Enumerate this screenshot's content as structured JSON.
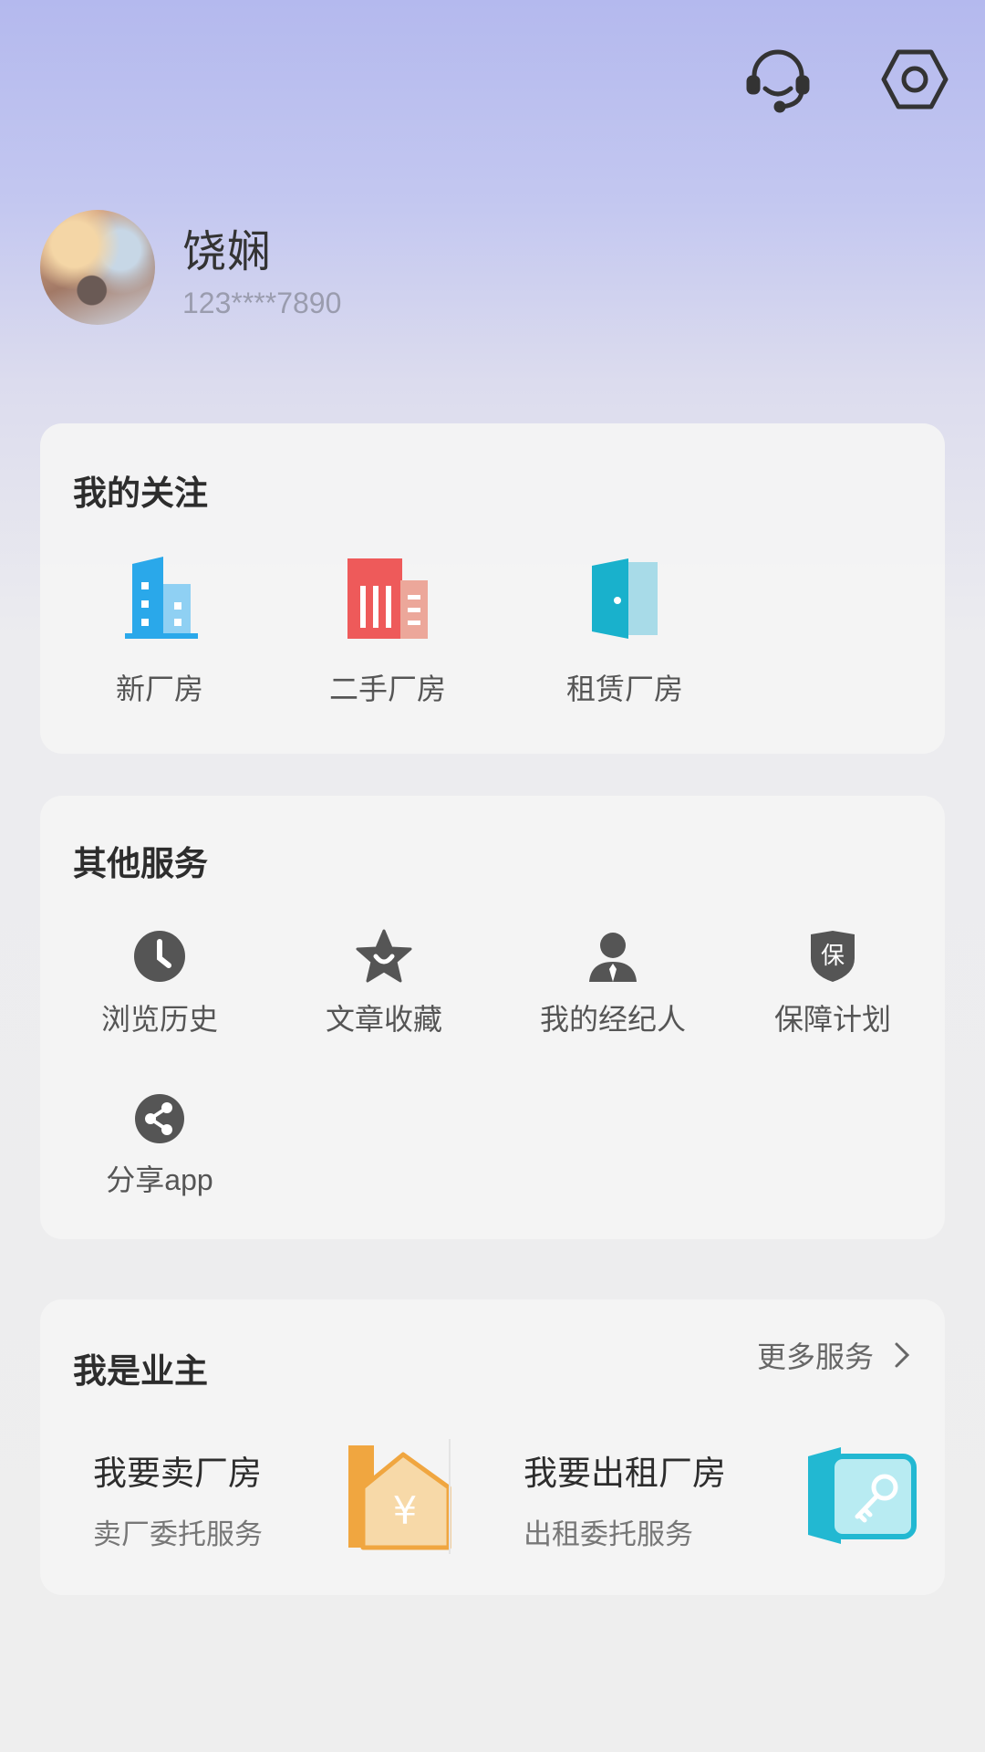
{
  "header": {
    "icons": [
      "headset-icon",
      "settings-icon"
    ]
  },
  "profile": {
    "name": "饶娴",
    "phone": "123****7890"
  },
  "my_follows": {
    "title": "我的关注",
    "items": [
      {
        "label": "新厂房",
        "icon": "new-building-icon",
        "color": "#2aa8ea"
      },
      {
        "label": "二手厂房",
        "icon": "used-building-icon",
        "color": "#ee5a5a"
      },
      {
        "label": "租赁厂房",
        "icon": "door-icon",
        "color": "#19b1cc"
      }
    ]
  },
  "other_services": {
    "title": "其他服务",
    "items": [
      {
        "label": "浏览历史",
        "icon": "clock-icon"
      },
      {
        "label": "文章收藏",
        "icon": "star-icon"
      },
      {
        "label": "我的经纪人",
        "icon": "agent-icon"
      },
      {
        "label": "保障计划",
        "icon": "shield-icon",
        "badge": "保"
      },
      {
        "label": "分享app",
        "icon": "share-icon"
      }
    ]
  },
  "owner": {
    "title": "我是业主",
    "more": "更多服务",
    "options": [
      {
        "title": "我要卖厂房",
        "subtitle": "卖厂委托服务",
        "icon": "house-yen-icon",
        "color": "#f0a640"
      },
      {
        "title": "我要出租厂房",
        "subtitle": "出租委托服务",
        "icon": "key-door-icon",
        "color": "#22b8d2"
      }
    ],
    "currency": "¥"
  }
}
